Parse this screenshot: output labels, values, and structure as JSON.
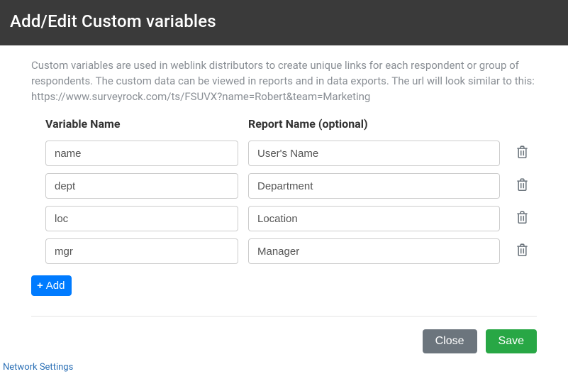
{
  "header": {
    "title": "Add/Edit Custom variables"
  },
  "description": "Custom variables are used in weblink distributors to create unique links for each respondent or group of respondents. The custom data can be viewed in reports and in data exports. The url will look similar to this: https://www.surveyrock.com/ts/FSUVX?name=Robert&team=Marketing",
  "columns": {
    "variable_name": "Variable Name",
    "report_name": "Report Name (optional)"
  },
  "rows": [
    {
      "var": "name",
      "report": "User's Name"
    },
    {
      "var": "dept",
      "report": "Department"
    },
    {
      "var": "loc",
      "report": "Location"
    },
    {
      "var": "mgr",
      "report": "Manager"
    }
  ],
  "buttons": {
    "add": "Add",
    "close": "Close",
    "save": "Save"
  },
  "behind_text": "Network Settings"
}
